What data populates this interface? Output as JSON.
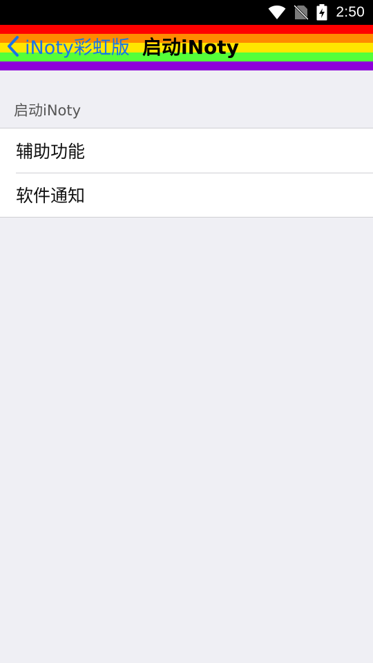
{
  "status_bar": {
    "time": "2:50",
    "icons": [
      "wifi-icon",
      "no-sim-icon",
      "battery-charging-icon"
    ]
  },
  "nav_bar": {
    "back_label": "iNoty彩虹版",
    "title": "启动iNoty",
    "rainbow_colors": [
      "#ff0000",
      "#ff8a00",
      "#ffe600",
      "#55ff3a",
      "#8e00d9"
    ]
  },
  "section": {
    "header": "启动iNoty",
    "items": [
      {
        "label": "辅助功能"
      },
      {
        "label": "软件通知"
      }
    ]
  }
}
